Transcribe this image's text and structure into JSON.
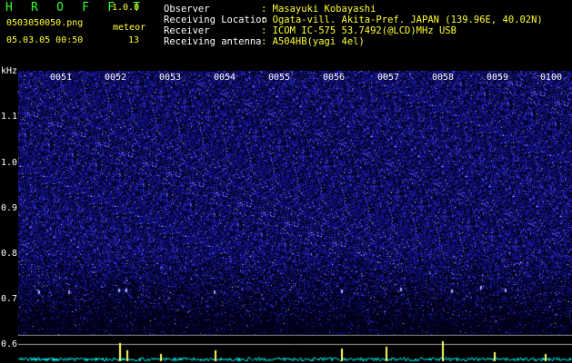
{
  "header": {
    "title": "H R O F F T",
    "version": "1.0.0",
    "filename": "0503050050.png",
    "datetime": "05.03.05 00:50",
    "meteor_label": "meteor",
    "meteor_count": "13"
  },
  "info": {
    "observer_label": "Observer",
    "observer_value": ": Masayuki Kobayashi",
    "location_label": "Receiving Location",
    "location_value": ": Ogata-vill. Akita-Pref. JAPAN (139.96E, 40.02N)",
    "receiver_label": "Receiver",
    "receiver_value": ": ICOM IC-575 53.7492(@LCD)MHz USB",
    "antenna_label": "Receiving antenna",
    "antenna_value": ": A504HB(yagi 4el)"
  },
  "axis": {
    "y_unit": "kHz",
    "y_ticks": [
      "1.1",
      "1.0",
      "0.9",
      "0.8",
      "0.7",
      "0.6"
    ],
    "x_ticks": [
      "0051",
      "0052",
      "0053",
      "0054",
      "0055",
      "0056",
      "0057",
      "0058",
      "0059",
      "0100"
    ]
  },
  "colors": {
    "accent_green": "#33ff33",
    "text_yellow": "#ffff33",
    "noise_blue": "#3b3bff",
    "trace_cyan": "#00ffff"
  }
}
